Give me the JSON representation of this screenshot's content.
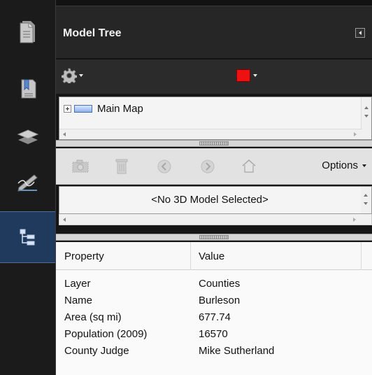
{
  "rail": {
    "buttons": [
      {
        "icon": "page-thumbnails-icon"
      },
      {
        "icon": "bookmarks-icon"
      },
      {
        "icon": "layers-icon"
      },
      {
        "icon": "signatures-icon"
      },
      {
        "icon": "model-tree-icon",
        "active": true
      }
    ]
  },
  "header": {
    "title": "Model Tree"
  },
  "toolbar1": {
    "color_swatch": "#ee1111"
  },
  "tree": {
    "items": [
      {
        "label": "Main Map"
      }
    ]
  },
  "toolbar2": {
    "options_label": "Options"
  },
  "model": {
    "placeholder": "<No 3D Model Selected>"
  },
  "properties": {
    "columns": [
      "Property",
      "Value"
    ],
    "rows": [
      [
        "Layer",
        "Counties"
      ],
      [
        "Name",
        "Burleson"
      ],
      [
        "Area (sq mi)",
        "677.74"
      ],
      [
        "Population (2009)",
        "16570"
      ],
      [
        "County Judge",
        "Mike Sutherland"
      ]
    ]
  }
}
